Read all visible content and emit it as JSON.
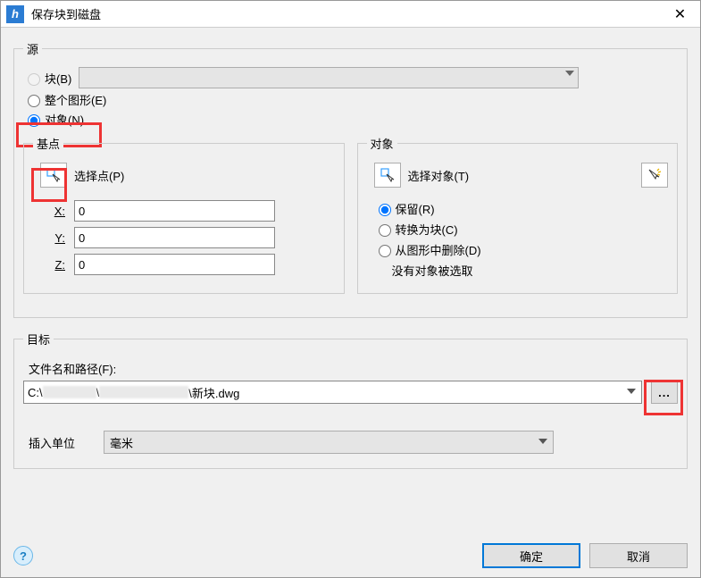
{
  "window": {
    "title": "保存块到磁盘"
  },
  "source": {
    "legend": "源",
    "block": {
      "label": "块(B)",
      "selected_value": ""
    },
    "whole": {
      "label": "整个图形(E)"
    },
    "objects": {
      "label": "对象(N)"
    }
  },
  "base": {
    "legend": "基点",
    "pick_label": "选择点(P)",
    "x_label": "X:",
    "y_label": "Y:",
    "z_label": "Z:",
    "x": "0",
    "y": "0",
    "z": "0"
  },
  "objects_panel": {
    "legend": "对象",
    "select_label": "选择对象(T)",
    "retain": "保留(R)",
    "convert": "转换为块(C)",
    "delete": "从图形中删除(D)",
    "status": "没有对象被选取"
  },
  "destination": {
    "legend": "目标",
    "path_label": "文件名和路径(F):",
    "path_prefix": "C:\\",
    "path_suffix": "\\新块.dwg",
    "units_label": "插入单位",
    "units_value": "毫米"
  },
  "buttons": {
    "ok": "确定",
    "cancel": "取消"
  }
}
